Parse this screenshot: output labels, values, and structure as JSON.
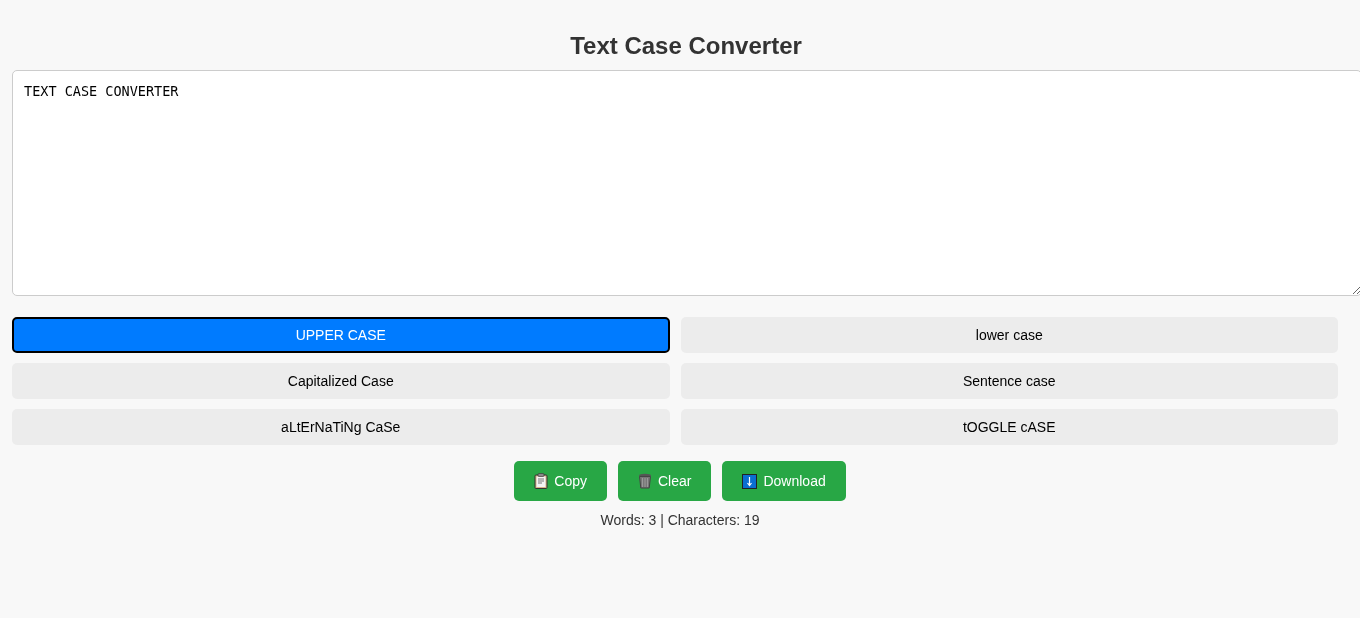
{
  "title": "Text Case Converter",
  "editor": {
    "value": "TEXT CASE CONVERTER"
  },
  "case_buttons": [
    {
      "label": "UPPER CASE",
      "selected": true
    },
    {
      "label": "lower case",
      "selected": false
    },
    {
      "label": "Capitalized Case",
      "selected": false
    },
    {
      "label": "Sentence case",
      "selected": false
    },
    {
      "label": "aLtErNaTiNg CaSe",
      "selected": false
    },
    {
      "label": "tOGGLE cASE",
      "selected": false
    }
  ],
  "actions": [
    {
      "kind": "copy",
      "label": "Copy"
    },
    {
      "kind": "clear",
      "label": "Clear"
    },
    {
      "kind": "download",
      "label": "Download"
    }
  ],
  "stats": "Words: 3 | Characters: 19"
}
